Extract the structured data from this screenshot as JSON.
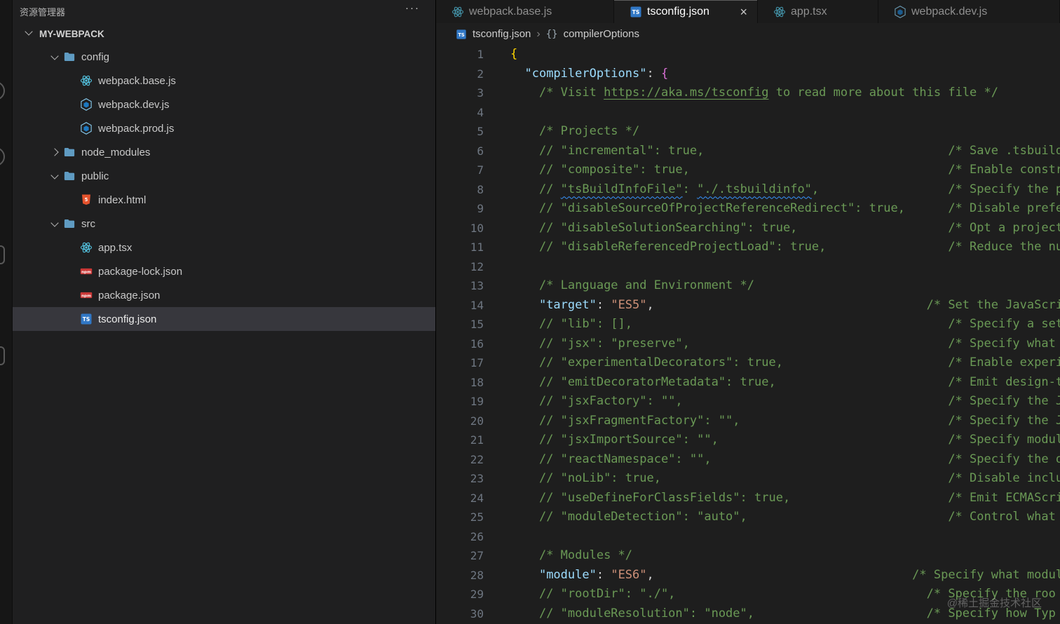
{
  "explorer": {
    "title": "资源管理器",
    "more_label": "···",
    "section": "MY-WEBPACK",
    "tree": [
      {
        "name": "config",
        "kind": "folder",
        "state": "expanded",
        "icon": "folder"
      },
      {
        "name": "webpack.base.js",
        "kind": "file",
        "icon": "react"
      },
      {
        "name": "webpack.dev.js",
        "kind": "file",
        "icon": "webpack"
      },
      {
        "name": "webpack.prod.js",
        "kind": "file",
        "icon": "webpack"
      },
      {
        "name": "node_modules",
        "kind": "folder",
        "state": "collapsed",
        "icon": "folder"
      },
      {
        "name": "public",
        "kind": "folder",
        "state": "expanded",
        "icon": "folder"
      },
      {
        "name": "index.html",
        "kind": "file",
        "icon": "html"
      },
      {
        "name": "src",
        "kind": "folder",
        "state": "expanded",
        "icon": "folder"
      },
      {
        "name": "app.tsx",
        "kind": "file",
        "icon": "react"
      },
      {
        "name": "package-lock.json",
        "kind": "file",
        "icon": "npm"
      },
      {
        "name": "package.json",
        "kind": "file",
        "icon": "npm"
      },
      {
        "name": "tsconfig.json",
        "kind": "file",
        "icon": "typescript",
        "selected": true
      }
    ]
  },
  "tabs": [
    {
      "label": "webpack.base.js",
      "icon": "react",
      "active": false
    },
    {
      "label": "tsconfig.json",
      "icon": "typescript",
      "active": true,
      "close_label": "×"
    },
    {
      "label": "app.tsx",
      "icon": "react",
      "active": false
    },
    {
      "label": "webpack.dev.js",
      "icon": "webpack",
      "active": false
    }
  ],
  "breadcrumb": {
    "file": "tsconfig.json",
    "separator": "›",
    "symbol_icon": "{}",
    "symbol": "compilerOptions"
  },
  "editor": {
    "language": "jsonc",
    "lines": [
      {
        "seg": [
          [
            "b1",
            "{"
          ]
        ]
      },
      {
        "seg": [
          [
            "ws",
            "  "
          ],
          [
            "key",
            "\"compilerOptions\""
          ],
          [
            "pn",
            ": "
          ],
          [
            "b2",
            "{"
          ]
        ]
      },
      {
        "seg": [
          [
            "ws",
            "    "
          ],
          [
            "cm",
            "/* Visit "
          ],
          [
            "lnk",
            "https://aka.ms/tsconfig"
          ],
          [
            "cm",
            " to read more about this file */"
          ]
        ]
      },
      {
        "seg": []
      },
      {
        "seg": [
          [
            "ws",
            "    "
          ],
          [
            "cm",
            "/* Projects */"
          ]
        ]
      },
      {
        "seg": [
          [
            "ws",
            "    "
          ],
          [
            "cm",
            "// \"incremental\": true,"
          ]
        ],
        "rc": {
          "col": 61,
          "t": "/* Save .tsbuildin"
        }
      },
      {
        "seg": [
          [
            "ws",
            "    "
          ],
          [
            "cm",
            "// \"composite\": true,"
          ]
        ],
        "rc": {
          "col": 61,
          "t": "/* Enable constrai"
        }
      },
      {
        "seg": [
          [
            "ws",
            "    "
          ],
          [
            "cm",
            "// "
          ],
          [
            "cm sq",
            "\"tsBuildInfoFile\""
          ],
          [
            "cm",
            ": "
          ],
          [
            "cm sq",
            "\"./.tsbuildinfo\""
          ],
          [
            "cm",
            ","
          ]
        ],
        "rc": {
          "col": 61,
          "t": "/* Specify the pat"
        }
      },
      {
        "seg": [
          [
            "ws",
            "    "
          ],
          [
            "cm",
            "// \"disableSourceOfProjectReferenceRedirect\": true,"
          ]
        ],
        "rc": {
          "col": 61,
          "t": "/* Disable prefer"
        }
      },
      {
        "seg": [
          [
            "ws",
            "    "
          ],
          [
            "cm",
            "// \"disableSolutionSearching\": true,"
          ]
        ],
        "rc": {
          "col": 61,
          "t": "/* Opt a project o"
        }
      },
      {
        "seg": [
          [
            "ws",
            "    "
          ],
          [
            "cm",
            "// \"disableReferencedProjectLoad\": true,"
          ]
        ],
        "rc": {
          "col": 61,
          "t": "/* Reduce the numb"
        }
      },
      {
        "seg": []
      },
      {
        "seg": [
          [
            "ws",
            "    "
          ],
          [
            "cm",
            "/* Language and Environment */"
          ]
        ]
      },
      {
        "seg": [
          [
            "ws",
            "    "
          ],
          [
            "key",
            "\"target\""
          ],
          [
            "pn",
            ": "
          ],
          [
            "str",
            "\"ES5\""
          ],
          [
            "pn",
            ","
          ]
        ],
        "rc": {
          "col": 58,
          "t": "/* Set the JavaScrip"
        }
      },
      {
        "seg": [
          [
            "ws",
            "    "
          ],
          [
            "cm",
            "// \"lib\": [],"
          ]
        ],
        "rc": {
          "col": 61,
          "t": "/* Specify a set o"
        }
      },
      {
        "seg": [
          [
            "ws",
            "    "
          ],
          [
            "cm",
            "// \"jsx\": \"preserve\","
          ]
        ],
        "rc": {
          "col": 61,
          "t": "/* Specify what JS"
        }
      },
      {
        "seg": [
          [
            "ws",
            "    "
          ],
          [
            "cm",
            "// \"experimentalDecorators\": true,"
          ]
        ],
        "rc": {
          "col": 61,
          "t": "/* Enable experime"
        }
      },
      {
        "seg": [
          [
            "ws",
            "    "
          ],
          [
            "cm",
            "// \"emitDecoratorMetadata\": true,"
          ]
        ],
        "rc": {
          "col": 61,
          "t": "/* Emit design-typ"
        }
      },
      {
        "seg": [
          [
            "ws",
            "    "
          ],
          [
            "cm",
            "// \"jsxFactory\": \"\","
          ]
        ],
        "rc": {
          "col": 61,
          "t": "/* Specify the JSX"
        }
      },
      {
        "seg": [
          [
            "ws",
            "    "
          ],
          [
            "cm",
            "// \"jsxFragmentFactory\": \"\","
          ]
        ],
        "rc": {
          "col": 61,
          "t": "/* Specify the JSX"
        }
      },
      {
        "seg": [
          [
            "ws",
            "    "
          ],
          [
            "cm",
            "// \"jsxImportSource\": \"\","
          ]
        ],
        "rc": {
          "col": 61,
          "t": "/* Specify module"
        }
      },
      {
        "seg": [
          [
            "ws",
            "    "
          ],
          [
            "cm",
            "// \"reactNamespace\": \"\","
          ]
        ],
        "rc": {
          "col": 61,
          "t": "/* Specify the obj"
        }
      },
      {
        "seg": [
          [
            "ws",
            "    "
          ],
          [
            "cm",
            "// \"noLib\": true,"
          ]
        ],
        "rc": {
          "col": 61,
          "t": "/* Disable includi"
        }
      },
      {
        "seg": [
          [
            "ws",
            "    "
          ],
          [
            "cm",
            "// \"useDefineForClassFields\": true,"
          ]
        ],
        "rc": {
          "col": 61,
          "t": "/* Emit ECMAScript"
        }
      },
      {
        "seg": [
          [
            "ws",
            "    "
          ],
          [
            "cm",
            "// \"moduleDetection\": \"auto\","
          ]
        ],
        "rc": {
          "col": 61,
          "t": "/* Control what me"
        }
      },
      {
        "seg": []
      },
      {
        "seg": [
          [
            "ws",
            "    "
          ],
          [
            "cm",
            "/* Modules */"
          ]
        ]
      },
      {
        "seg": [
          [
            "ws",
            "    "
          ],
          [
            "key",
            "\"module\""
          ],
          [
            "pn",
            ": "
          ],
          [
            "str",
            "\"ES6\""
          ],
          [
            "pn",
            ","
          ]
        ],
        "rc": {
          "col": 56,
          "t": "/* Specify what modul"
        }
      },
      {
        "seg": [
          [
            "ws",
            "    "
          ],
          [
            "cm",
            "// \"rootDir\": \"./\","
          ]
        ],
        "rc": {
          "col": 58,
          "t": "/* Specify the roo"
        }
      },
      {
        "seg": [
          [
            "ws",
            "    "
          ],
          [
            "cm",
            "// \"moduleResolution\": \"node\","
          ]
        ],
        "rc": {
          "col": 58,
          "t": "/* Specify how Typ"
        }
      }
    ]
  },
  "watermark": "@稀土掘金技术社区",
  "colors": {
    "comment": "#6a9955",
    "string": "#ce9178",
    "property": "#9cdcfe",
    "bracket_level1": "#ffd700",
    "bracket_level2": "#da70d6",
    "squiggle": "#3794ff",
    "selection_bg": "#37373d",
    "react_icon": "#53c1de",
    "webpack_icon": "#8ed6fb",
    "npm_icon": "#cb3837",
    "html_icon": "#e5532d",
    "typescript_icon": "#3178c6",
    "folder_icon": "#5f9bc2"
  }
}
